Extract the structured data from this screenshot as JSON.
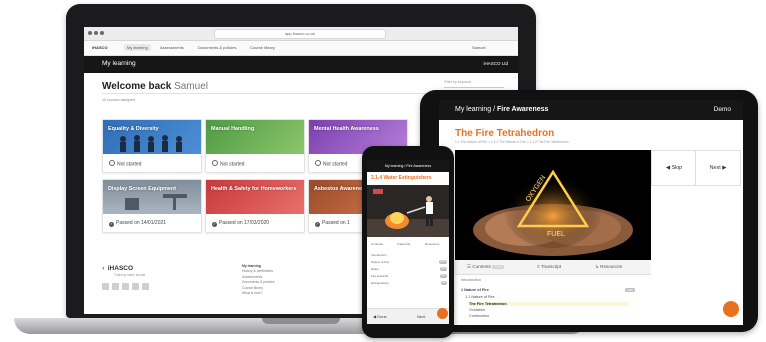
{
  "laptop": {
    "browser": {
      "url": "app.ihasco.co.uk"
    },
    "nav": {
      "logo": "iHASCO",
      "items": [
        "My learning",
        "Assessments",
        "Documents & policies",
        "Course library"
      ],
      "account": "Samuel"
    },
    "page_title": "My learning",
    "org_name": "iHASCO Ltd",
    "welcome_prefix": "Welcome back",
    "welcome_name": "Samuel",
    "course_count": "10 courses assigned",
    "search_placeholder": "Filter by keyword",
    "courses": [
      {
        "title": "Equality & Diversity",
        "status": "Not started",
        "color": "#3a78c2"
      },
      {
        "title": "Manual Handling",
        "status": "Not started",
        "color": "#5ea84e"
      },
      {
        "title": "Mental Health Awareness",
        "status": "Not started",
        "color": "#8a4bb5"
      },
      {
        "title": "Display Screen Equipment",
        "status": "Passed on 14/01/2021",
        "color": "#8d9ba8"
      },
      {
        "title": "Health & Safety for Homeworkers",
        "status": "Passed on 17/03/2020",
        "color": "#d8484a"
      },
      {
        "title": "Asbestos Awareness",
        "status": "Passed on 1",
        "color": "#b35a34"
      }
    ],
    "footer": {
      "brand": "iHASCO",
      "tagline": "Training made simple",
      "links_heading": "My learning",
      "links": [
        "History & certificates",
        "Assessments",
        "Documents & policies",
        "Course library",
        "What is new?"
      ]
    }
  },
  "tablet": {
    "breadcrumb_root": "My learning",
    "breadcrumb_current": "Fire Awareness",
    "demo_label": "Demo",
    "lesson_title": "The Fire Tetrahedron",
    "crumbs": "1.1 The Nature of Fire  >  1.1.2 The Nature of Fire  >  1.1.2 The Fire Tetrahedron",
    "prev_label": "Skip",
    "next_label": "Next",
    "tabs": {
      "contents": "Contents",
      "contents_badge": "23/41",
      "transcript": "Transcript",
      "resources": "Resources"
    },
    "list": {
      "intro": "Introduction",
      "section": "1 Nature of Fire",
      "section_badge": "6/10",
      "sub_section": "1.1 Nature of Fire",
      "items": [
        "The Fire Tetrahedron",
        "Oxidation",
        "Combustion"
      ]
    },
    "video_words": [
      "OXYGEN",
      "FUEL"
    ],
    "accent": "#e8711f"
  },
  "phone": {
    "header": "My learning / Fire Awareness",
    "lesson_title": "2.1.4 Water Extinguishers",
    "tabs": [
      "Contents",
      "Transcript",
      "Resources"
    ],
    "items": [
      {
        "label": "Introduction",
        "badge": ""
      },
      {
        "label": "Nature of Fire",
        "badge": "10/10"
      },
      {
        "label": "Risks",
        "badge": "3/10"
      },
      {
        "label": "Fire Hazards",
        "badge": "5/10"
      },
      {
        "label": "Extinguishers",
        "badge": "0/8"
      }
    ],
    "prev_label": "Done",
    "next_label": "Next"
  }
}
